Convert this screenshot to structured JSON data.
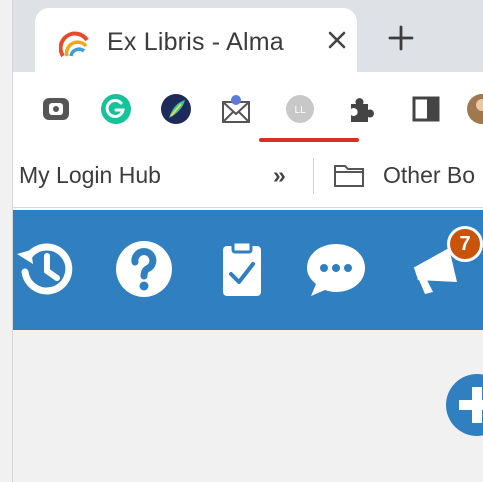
{
  "tab": {
    "title": "Ex Libris - Alma",
    "favicon": "ex-libris-rainbow-arc-icon",
    "close_icon": "close-icon"
  },
  "toolbar": {
    "new_tab_icon": "plus-icon",
    "extensions": [
      {
        "name": "screenshot-extension-icon"
      },
      {
        "name": "grammarly-icon"
      },
      {
        "name": "feather-extension-icon"
      },
      {
        "name": "mail-extension-icon"
      },
      {
        "name": "profile-extension-icon",
        "label": "LL"
      },
      {
        "name": "puzzle-piece-icon"
      },
      {
        "name": "side-panel-icon"
      }
    ]
  },
  "bookmarks": {
    "login_hub": "My Login Hub",
    "more": "»",
    "other": "Other Bo"
  },
  "alma": {
    "icons": [
      "history-icon",
      "help-icon",
      "tasks-clipboard-icon",
      "chat-icon",
      "announcements-megaphone-icon"
    ],
    "notification_count": "7"
  },
  "colors": {
    "alma_blue": "#2f7fc1",
    "badge_orange": "#c9530a",
    "highlight_red": "#d93025"
  }
}
